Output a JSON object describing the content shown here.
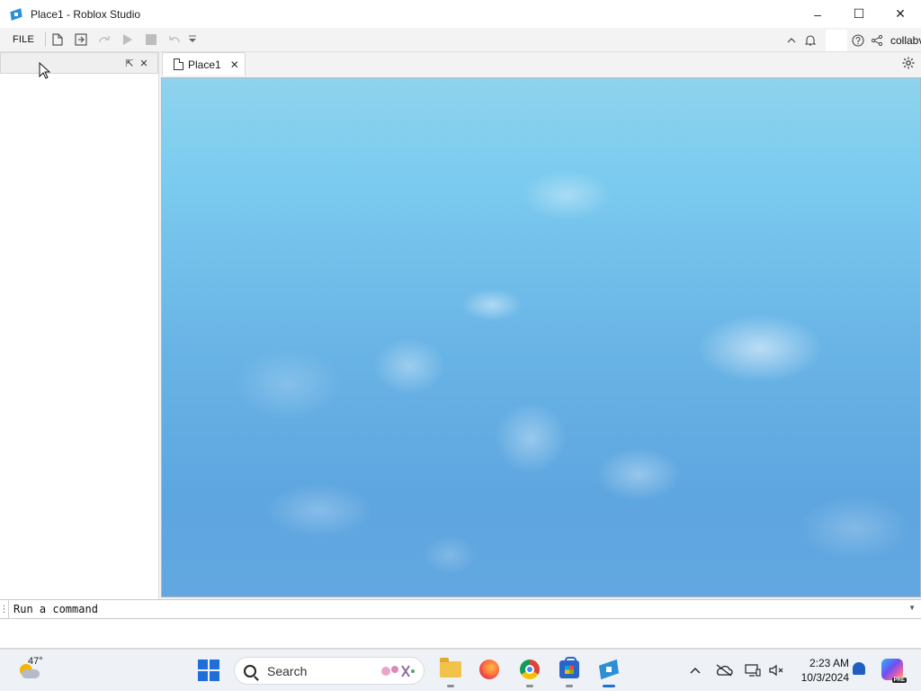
{
  "window": {
    "title": "Place1 - Roblox Studio",
    "controls": {
      "minimize": "–",
      "maximize": "☐",
      "close": "✕"
    }
  },
  "toolbar": {
    "file_label": "FILE",
    "quick_icons": [
      "new-file-icon",
      "publish-icon",
      "redo-icon",
      "play-icon",
      "stop-icon",
      "undo-icon",
      "customize-icon"
    ],
    "right_label": "collabv"
  },
  "left_panel": {
    "float_icon": "⇱",
    "close_icon": "✕"
  },
  "tabs": [
    {
      "label": "Place1",
      "close": "✕"
    }
  ],
  "viewport": {
    "description_colors": {
      "sky_top": "#8fd3ec",
      "sky_bottom": "#5ea6e0"
    }
  },
  "command_bar": {
    "text": "Run a command",
    "grip": "⋮",
    "dropdown": "▼"
  },
  "taskbar": {
    "weather_temp": "47°",
    "search_label": "Search",
    "time": "2:23 AM",
    "date": "10/3/2024",
    "copilot_badge": "PRE"
  },
  "colors": {
    "accent": "#1e6fd9",
    "roblox_blue": "#2d8fd5"
  }
}
